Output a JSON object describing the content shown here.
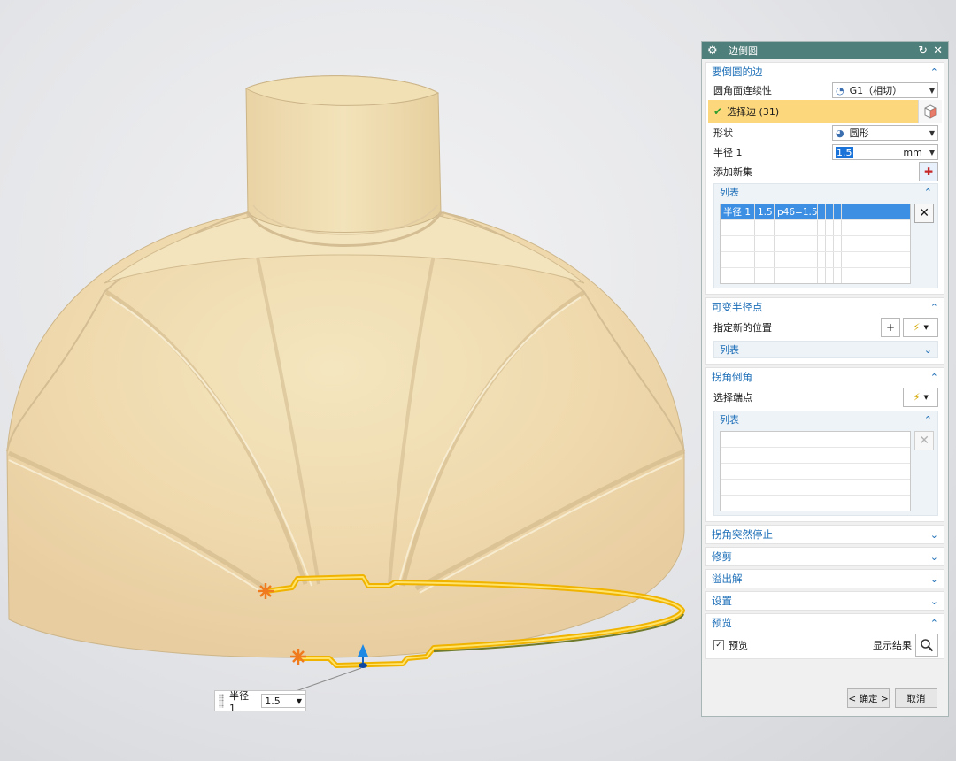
{
  "dialog": {
    "title": "边倒圆",
    "reset_icon": "↻",
    "close_icon": "✕",
    "edges_section": {
      "title": "要倒圆的边",
      "continuity_label": "圆角面连续性",
      "continuity_value": "G1（相切）",
      "select_edge": "选择边 (31)",
      "shape_label": "形状",
      "shape_value": "圆形",
      "radius_label": "半径 1",
      "radius_value": "1.5",
      "radius_unit": "mm",
      "add_set_label": "添加新集",
      "list": {
        "title": "列表",
        "rows": [
          {
            "name": "半径 1",
            "value": "1.5",
            "expr": "p46=1.5"
          }
        ]
      }
    },
    "variable_section": {
      "title": "可变半径点",
      "location_label": "指定新的位置",
      "list_title": "列表"
    },
    "corner_section": {
      "title": "拐角倒角",
      "endpoint_label": "选择端点",
      "list_title": "列表"
    },
    "collapsed_sections": [
      {
        "title": "拐角突然停止"
      },
      {
        "title": "修剪"
      },
      {
        "title": "溢出解"
      },
      {
        "title": "设置"
      }
    ],
    "preview_section": {
      "title": "预览",
      "preview_checkbox": "预览",
      "show_result": "显示结果"
    },
    "ok_button": "< 确定 >",
    "cancel_button": "取消"
  },
  "callout": {
    "label": "半径 1",
    "value": "1.5"
  },
  "colors": {
    "titlebar": "#4f7f7a",
    "section_header": "#1e6fb8",
    "selection_highlight": "#fdd77c",
    "model_body": "#f1dcb0",
    "selected_edge": "#f5c518"
  }
}
